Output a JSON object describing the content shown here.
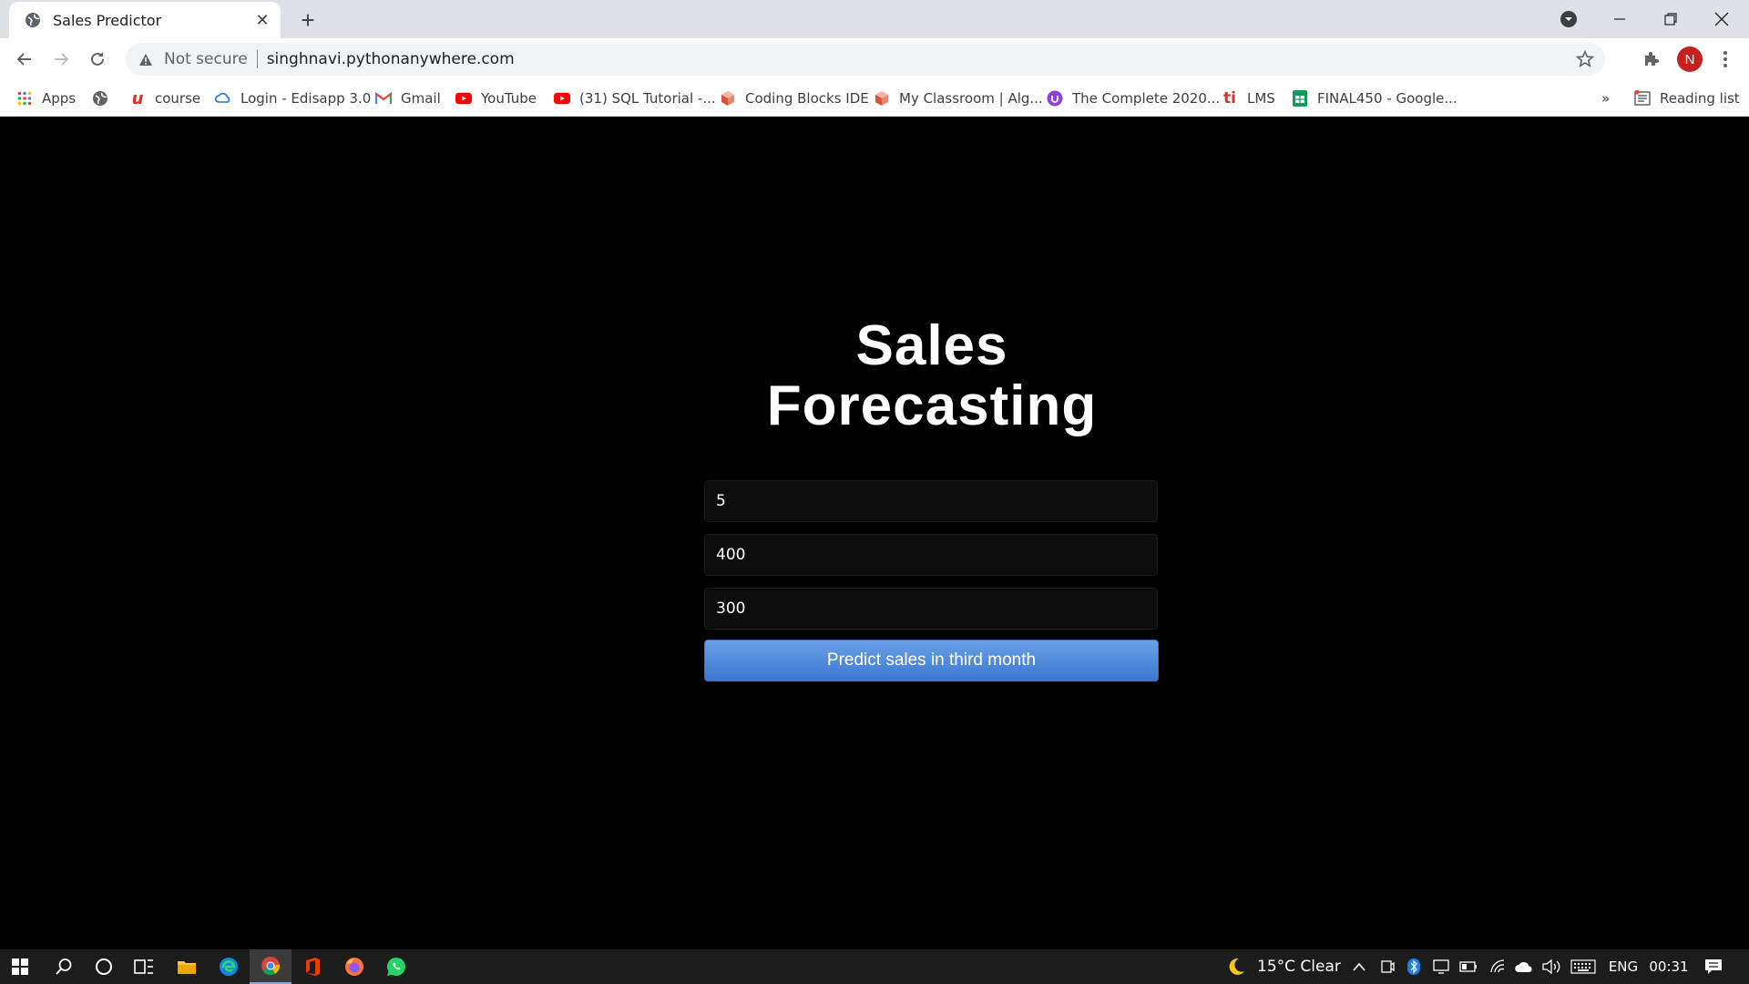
{
  "browser": {
    "tab": {
      "title": "Sales Predictor"
    },
    "address": {
      "security_label": "Not secure",
      "url": "singhnavi.pythonanywhere.com"
    },
    "profile_initial": "N",
    "bookmarks": [
      {
        "label": "Apps",
        "icon": "apps-grid-icon"
      },
      {
        "label": "",
        "icon": "globe-icon"
      },
      {
        "label": "course",
        "icon": "course-logo-icon"
      },
      {
        "label": "Login - Edisapp 3.0",
        "icon": "cloud-icon"
      },
      {
        "label": "Gmail",
        "icon": "gmail-icon"
      },
      {
        "label": "YouTube",
        "icon": "youtube-icon"
      },
      {
        "label": "(31) SQL Tutorial -...",
        "icon": "youtube-icon"
      },
      {
        "label": "Coding Blocks IDE",
        "icon": "cube-icon"
      },
      {
        "label": "My Classroom | Alg...",
        "icon": "cube-icon"
      },
      {
        "label": "The Complete 2020...",
        "icon": "udemy-icon"
      },
      {
        "label": "LMS",
        "icon": "lms-icon"
      },
      {
        "label": "FINAL450 - Google...",
        "icon": "sheets-icon"
      }
    ],
    "overflow_label": "»",
    "reading_list": "Reading list"
  },
  "page": {
    "heading_line1": "Sales",
    "heading_line2": "Forecasting",
    "inputs": [
      "5",
      "400",
      "300"
    ],
    "submit_label": "Predict sales in third month"
  },
  "taskbar": {
    "weather": "15°C  Clear",
    "language": "ENG",
    "time": "00:31"
  },
  "colors": {
    "button_top": "#6aa0e8",
    "button_bottom": "#3c78d0",
    "avatar": "#c5221f"
  }
}
